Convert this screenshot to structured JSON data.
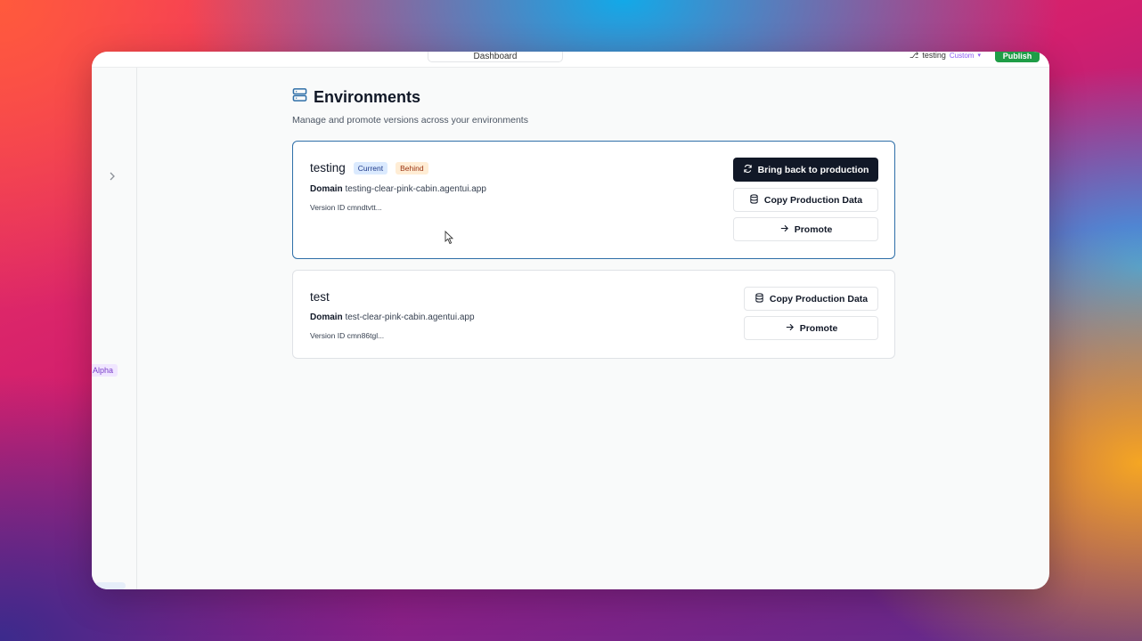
{
  "topbar": {
    "dashboard_tab": "Dashboard",
    "env_name": "testing",
    "env_tag": "Custom",
    "publish_label": "Publish"
  },
  "sidebar": {
    "expand_icon": "chevron-right-icon",
    "alpha_badge": "Alpha"
  },
  "page": {
    "title": "Environments",
    "title_icon": "server-icon",
    "subtitle": "Manage and promote versions across your environments"
  },
  "environments": [
    {
      "name": "testing",
      "badges": [
        "Current",
        "Behind"
      ],
      "domain_label": "Domain",
      "domain": "testing-clear-pink-cabin.agentui.app",
      "version_label": "Version ID",
      "version_id": "cmndtvtt...",
      "actions": {
        "bring_back": "Bring back to production",
        "copy": "Copy Production Data",
        "promote": "Promote"
      }
    },
    {
      "name": "test",
      "domain_label": "Domain",
      "domain": "test-clear-pink-cabin.agentui.app",
      "version_label": "Version ID",
      "version_id": "cmn86tgl...",
      "actions": {
        "copy": "Copy Production Data",
        "promote": "Promote"
      }
    }
  ],
  "colors": {
    "accent_border": "#2f6fa8",
    "primary_button": "#111827",
    "publish_green": "#1f9d47",
    "badge_current_bg": "#dbeafe",
    "badge_behind_bg": "#ffedd5"
  }
}
